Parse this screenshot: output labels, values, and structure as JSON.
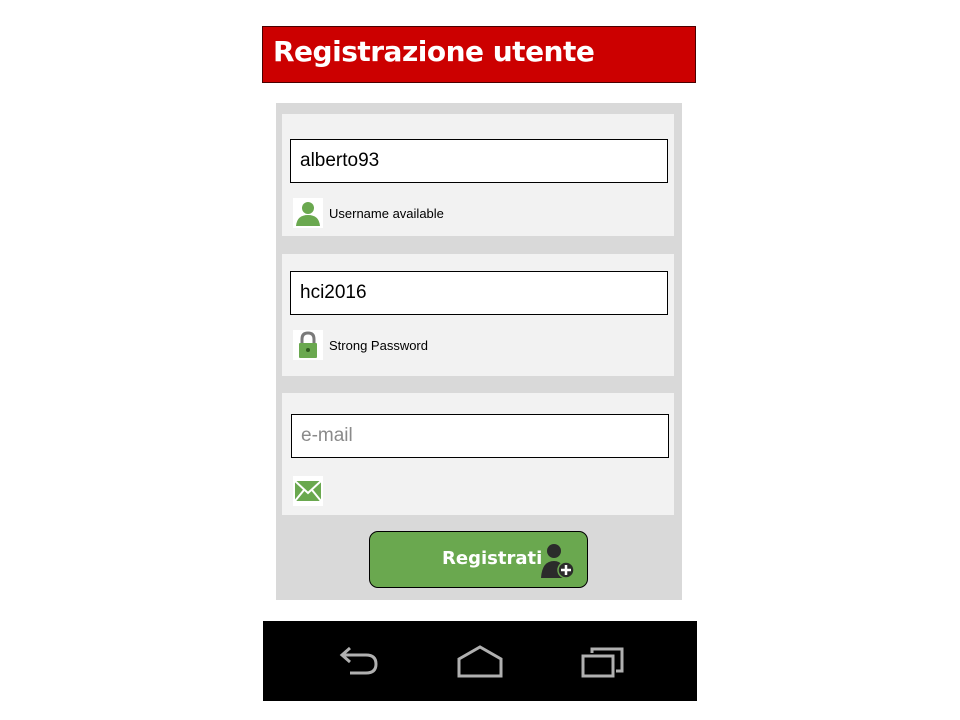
{
  "header": {
    "title": "Registrazione utente",
    "background": "#cc0000"
  },
  "form": {
    "username": {
      "value": "alberto93",
      "status_text": "Username available",
      "status_icon": "user-icon"
    },
    "password": {
      "value": "hci2016",
      "status_text": "Strong Password",
      "status_icon": "lock-icon"
    },
    "email": {
      "value": "",
      "placeholder": "e-mail",
      "status_icon": "mail-icon"
    },
    "submit": {
      "label": "Registrati",
      "icon": "add-user-icon",
      "color": "#6aa84f"
    }
  },
  "navbar": {
    "buttons": [
      {
        "name": "back",
        "icon": "back-icon"
      },
      {
        "name": "home",
        "icon": "home-icon"
      },
      {
        "name": "recents",
        "icon": "recents-icon"
      }
    ]
  }
}
